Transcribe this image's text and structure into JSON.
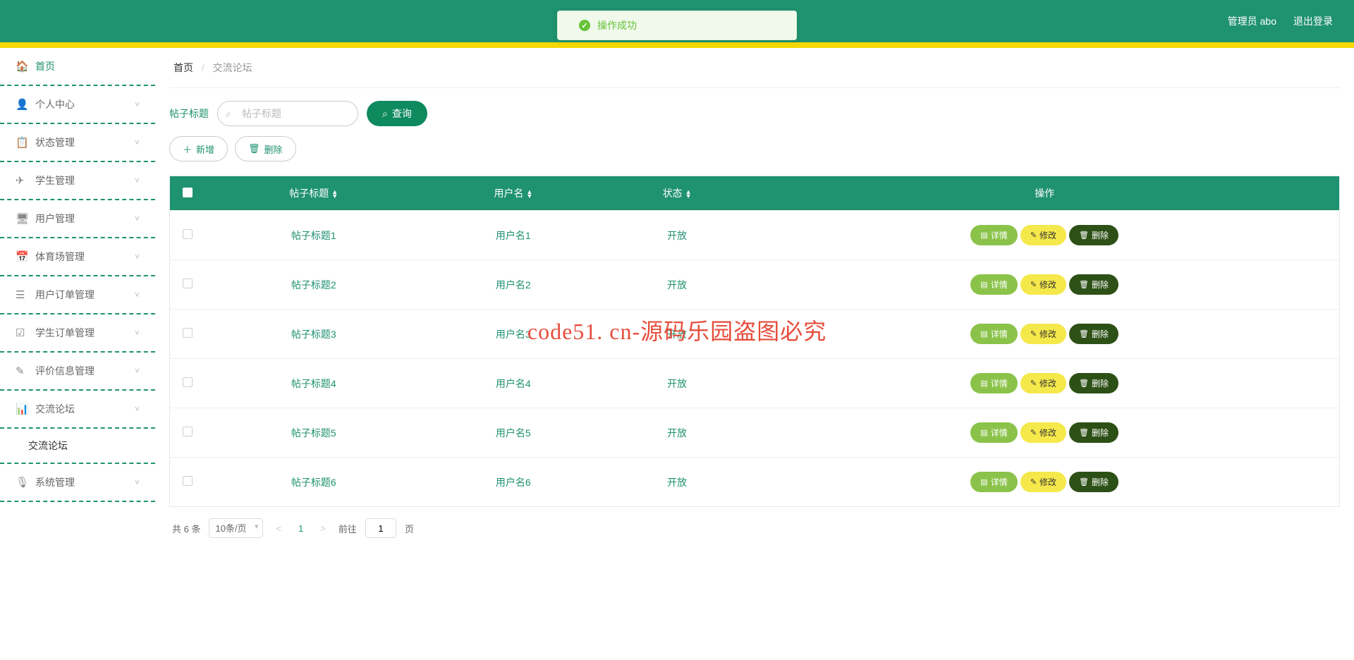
{
  "header": {
    "user_label": "管理员 abo",
    "logout": "退出登录"
  },
  "toast": {
    "text": "操作成功"
  },
  "sidebar": {
    "items": [
      {
        "label": "首页",
        "icon": "🏠",
        "home": true
      },
      {
        "label": "个人中心",
        "icon": "👤",
        "expandable": true
      },
      {
        "label": "状态管理",
        "icon": "📋",
        "expandable": true
      },
      {
        "label": "学生管理",
        "icon": "✈",
        "expandable": true
      },
      {
        "label": "用户管理",
        "icon": "🖥",
        "expandable": true
      },
      {
        "label": "体育场管理",
        "icon": "📅",
        "expandable": true
      },
      {
        "label": "用户订单管理",
        "icon": "☰",
        "expandable": true
      },
      {
        "label": "学生订单管理",
        "icon": "☑",
        "expandable": true
      },
      {
        "label": "评价信息管理",
        "icon": "✎",
        "expandable": true
      },
      {
        "label": "交流论坛",
        "icon": "📊",
        "expandable": true,
        "open": true,
        "children": [
          "交流论坛"
        ]
      },
      {
        "label": "系统管理",
        "icon": "🎙",
        "expandable": true
      }
    ]
  },
  "breadcrumb": {
    "first": "首页",
    "sep": "/",
    "current": "交流论坛"
  },
  "filter": {
    "label": "帖子标题",
    "placeholder": "帖子标题",
    "query": "查询"
  },
  "actions": {
    "add": "新增",
    "delete": "删除"
  },
  "table": {
    "headers": {
      "title": "帖子标题",
      "user": "用户名",
      "status": "状态",
      "ops": "操作"
    },
    "btn": {
      "detail": "详情",
      "edit": "修改",
      "delete": "删除"
    },
    "rows": [
      {
        "title": "帖子标题1",
        "user": "用户名1",
        "status": "开放"
      },
      {
        "title": "帖子标题2",
        "user": "用户名2",
        "status": "开放"
      },
      {
        "title": "帖子标题3",
        "user": "用户名3",
        "status": "开放"
      },
      {
        "title": "帖子标题4",
        "user": "用户名4",
        "status": "开放"
      },
      {
        "title": "帖子标题5",
        "user": "用户名5",
        "status": "开放"
      },
      {
        "title": "帖子标题6",
        "user": "用户名6",
        "status": "开放"
      }
    ]
  },
  "pager": {
    "total_label": "共 6 条",
    "page_size": "10条/页",
    "current": "1",
    "goto_prefix": "前往",
    "goto_value": "1",
    "goto_suffix": "页"
  },
  "watermark": "code51. cn-源码乐园盗图必究"
}
